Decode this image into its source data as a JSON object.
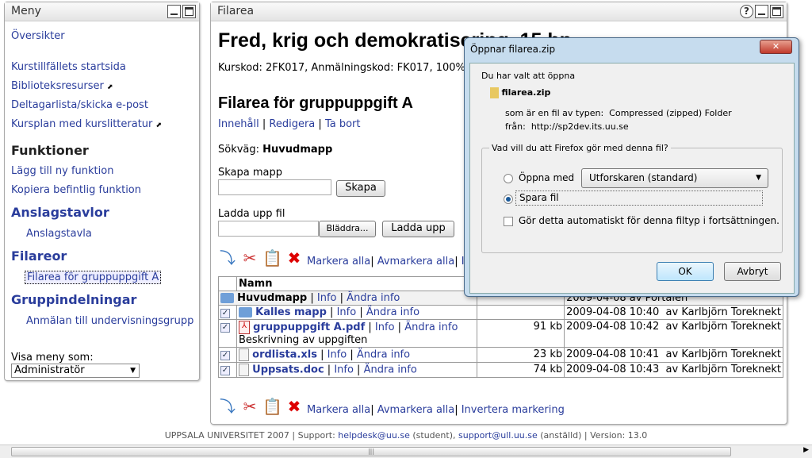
{
  "menu": {
    "title": "Meny",
    "items": [
      {
        "label": "Översikter"
      },
      {
        "label": "Kurstillfällets startsida"
      },
      {
        "label": "Biblioteksresurser"
      },
      {
        "label": "Deltagarlista/skicka e-post"
      },
      {
        "label": "Kursplan med kurslitteratur"
      }
    ],
    "funktioner": "Funktioner",
    "funk_items": [
      "Lägg till ny funktion",
      "Kopiera befintlig funktion"
    ],
    "anslag": "Anslagstavlor",
    "anslag_item": "Anslagstavla",
    "filareor": "Filareor",
    "filarea_item": "Filarea för gruppuppgift A",
    "grupp": "Gruppindelningar",
    "grupp_item": "Anmälan till undervisningsgrupp",
    "visa_label": "Visa meny som:",
    "visa_value": "Administratör"
  },
  "main": {
    "title": "Filarea",
    "course_title": "Fred, krig och demokratisering, 15 hp",
    "course_info": "Kurskod: 2FK017, Anmälningskod: FK017, 100%,",
    "heading": "Filarea för gruppuppgift A",
    "links": [
      "Innehåll",
      "Redigera",
      "Ta bort"
    ],
    "path_label": "Sökväg:",
    "path_value": "Huvudmapp",
    "create_label": "Skapa mapp",
    "create_btn": "Skapa",
    "upload_label": "Ladda upp fil",
    "browse_btn": "Bläddra...",
    "upload_btn": "Ladda upp",
    "select_all": "Markera alla",
    "deselect_all": "Avmarkera alla",
    "invert": "Invertera markering",
    "col_name": "Namn",
    "info": "Info",
    "edit_info": "Ändra info",
    "root": {
      "name": "Huvudmapp",
      "date": "2009-04-08 av Portalen"
    },
    "rows": [
      {
        "name": "Kalles mapp",
        "type": "folder",
        "size": "",
        "date": "2009-04-08 10:40",
        "by": "av Karlbjörn Toreknekt",
        "desc": ""
      },
      {
        "name": "gruppuppgift A.pdf",
        "type": "pdf",
        "size": "91 kb",
        "date": "2009-04-08 10:42",
        "by": "av Karlbjörn Toreknekt",
        "desc": "Beskrivning av uppgiften"
      },
      {
        "name": "ordlista.xls",
        "type": "doc",
        "size": "23 kb",
        "date": "2009-04-08 10:41",
        "by": "av Karlbjörn Toreknekt",
        "desc": ""
      },
      {
        "name": "Uppsats.doc",
        "type": "doc",
        "size": "74 kb",
        "date": "2009-04-08 10:43",
        "by": "av Karlbjörn Toreknekt",
        "desc": ""
      }
    ]
  },
  "footer": {
    "pre": "UPPSALA UNIVERSITET 2007 | Support: ",
    "mail1": "helpdesk@uu.se",
    "mid": " (student), ",
    "mail2": "support@ull.uu.se",
    "post": " (anställd) | Version: 13.0"
  },
  "dialog": {
    "title": "Öppnar filarea.zip",
    "intro": "Du har valt att öppna",
    "filename": "filarea.zip",
    "type_label": "som är en fil av typen:",
    "type_value": "Compressed (zipped) Folder",
    "from_label": "från:",
    "from_value": "http://sp2dev.its.uu.se",
    "question": "Vad vill du att Firefox gör med denna fil?",
    "open_with": "Öppna med",
    "app": "Utforskaren (standard)",
    "save": "Spara fil",
    "auto": "Gör detta automatiskt för denna filtyp i fortsättningen.",
    "ok": "OK",
    "cancel": "Avbryt",
    "selected_option": "save"
  }
}
